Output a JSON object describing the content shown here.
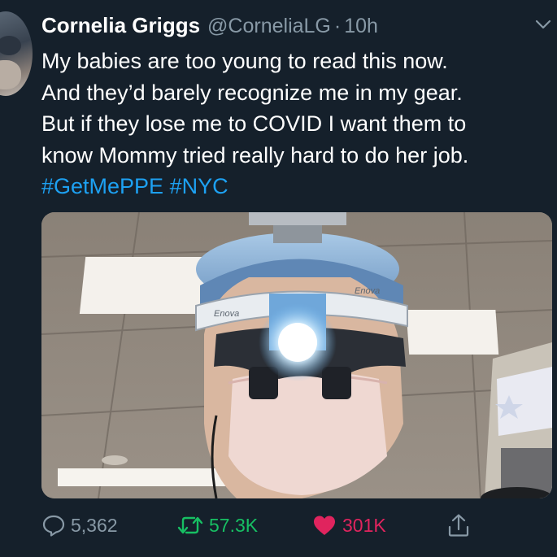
{
  "tweet": {
    "author_name": "Cornelia Griggs",
    "handle": "@CorneliaLG",
    "separator": "·",
    "timestamp": "10h",
    "text_lines": [
      "My babies are too young to read this now.",
      "And they’d barely recognize me in my gear.",
      "But if they lose me to COVID I want them to",
      "know Mommy tried really hard to do her job."
    ],
    "hashtags": [
      "#GetMePPE",
      "#NYC"
    ],
    "media": {
      "headlamp_brand_left": "Enova",
      "headlamp_brand_right": "Enova"
    }
  },
  "actions": {
    "reply_count": "5,362",
    "retweet_count": "57.3K",
    "like_count": "301K",
    "reply_icon": "reply-icon",
    "retweet_icon": "retweet-icon",
    "like_icon": "heart-icon",
    "share_icon": "share-icon"
  },
  "colors": {
    "background": "#15202b",
    "secondary_text": "#8899a6",
    "link": "#1da1f2",
    "retweet_active": "#17bf63",
    "like_active": "#e0245e"
  }
}
